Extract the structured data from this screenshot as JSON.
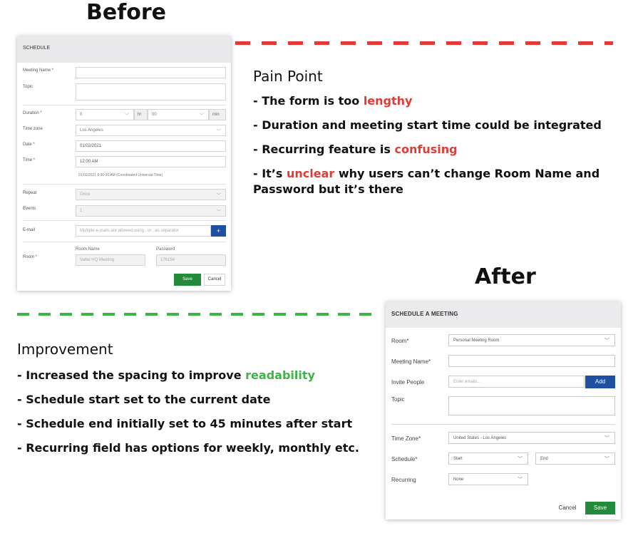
{
  "before_heading": "Before",
  "after_heading": "After",
  "pain": {
    "title": "Pain Point",
    "items": [
      {
        "pre": "- The form is too ",
        "hl": "lengthy",
        "post": ""
      },
      {
        "pre": "- Duration and meeting start time could be integrated",
        "hl": "",
        "post": ""
      },
      {
        "pre": "- Recurring feature is ",
        "hl": "confusing",
        "post": ""
      },
      {
        "pre": "- It’s ",
        "hl": "unclear",
        "post": " why users can’t change Room Name and Password but it’s there"
      }
    ]
  },
  "improvement": {
    "title": "Improvement",
    "items": [
      {
        "pre": "- Increased the spacing to improve ",
        "hl": "readability",
        "post": ""
      },
      {
        "pre": "- Schedule start set to the current date",
        "hl": "",
        "post": ""
      },
      {
        "pre": "- Schedule end initially set to 45 minutes after start",
        "hl": "",
        "post": ""
      },
      {
        "pre": "- Recurring field has options for weekly, monthly etc.",
        "hl": "",
        "post": ""
      }
    ]
  },
  "before_form": {
    "title": "SCHEDULE",
    "meeting_name_label": "Meeting Name *",
    "topic_label": "Topic",
    "duration_label": "Duration *",
    "duration_hours": "0",
    "duration_hr_unit": "hr",
    "duration_minutes": "00",
    "duration_min_unit": "min",
    "timezone_label": "Time zone",
    "timezone_value": "Los Angeles",
    "date_label": "Date *",
    "date_value": "01/02/2021",
    "time_label": "Time *",
    "time_value": "12:00 AM",
    "time_note": "01/02/2021 8:00:00 AM (Coordinated Universal Time)",
    "repeat_label": "Repeat",
    "repeat_value": "Once",
    "events_label": "Events",
    "events_value": "1",
    "email_label": "E-mail",
    "email_placeholder": "Multiple e-mails are allowed using , or ; as separator",
    "email_add": "+",
    "room_label": "Room *",
    "room_name_label": "Room Name",
    "room_name_value": "Valtel HQ Meeting",
    "password_label": "Password",
    "password_value": "176154",
    "save": "Save",
    "cancel": "Cancel"
  },
  "after_form": {
    "title": "SCHEDULE A MEETING",
    "room_label": "Room*",
    "room_value": "Personal Meeting Room",
    "meeting_name_label": "Meeting Name*",
    "invite_label": "Invite People",
    "invite_placeholder": "Enter emails...",
    "add": "Add",
    "topic_label": "Topic",
    "timezone_label": "Time Zone*",
    "timezone_value": "United States - Los Angeles",
    "schedule_label": "Schedule*",
    "start_value": "Start",
    "end_value": "End",
    "recurring_label": "Recurring",
    "recurring_value": "None",
    "cancel": "Cancel",
    "save": "Save"
  },
  "icons": {
    "chevron": "chevron-down-icon"
  }
}
